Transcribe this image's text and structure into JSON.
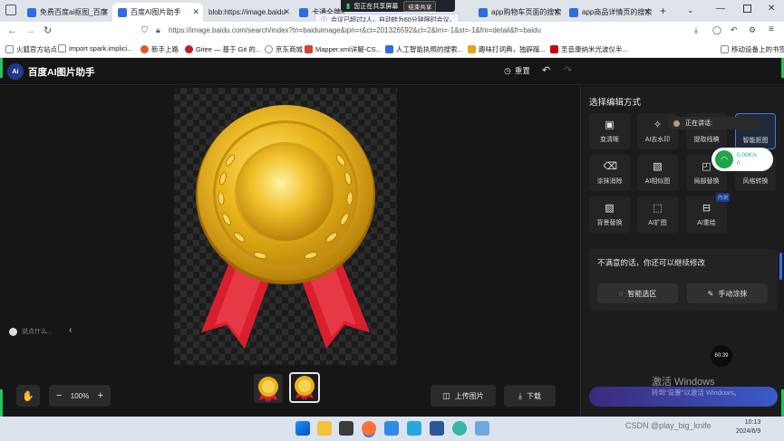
{
  "tabs": [
    {
      "label": "免费百度ai抠图_百度"
    },
    {
      "label": "百度AI图片助手"
    },
    {
      "label": "blob:https://image.baidu"
    },
    {
      "label": "卡通全牌的"
    },
    {
      "label": "app购物车页面的搜索"
    },
    {
      "label": "app商品详情页的搜索"
    }
  ],
  "share": {
    "text": "您正在共享屏幕",
    "end_label": "结束共享"
  },
  "notice": {
    "text": "会议已超过2人，自动转为60分钟限时会议。"
  },
  "address": {
    "url": "https://image.baidu.com/search/index?tn=baiduimage&ipn=r&ct=201326592&cl=2&lm=-1&st=-1&fm=detail&fr=baidu"
  },
  "bookmarks": [
    {
      "label": "火狐官方站点"
    },
    {
      "label": "import spark.implici..."
    },
    {
      "label": "新手上路"
    },
    {
      "label": "Gitee — 基于 Git 的..."
    },
    {
      "label": "京东商城"
    },
    {
      "label": "Mapper.xml详解-CS..."
    },
    {
      "label": "人工智能执照的搜索..."
    },
    {
      "label": "趣味打词典，独辟蹊..."
    },
    {
      "label": "圣音康纳米光波仪半..."
    },
    {
      "label": "移动设备上的书签"
    }
  ],
  "app": {
    "logo": "Ai",
    "title": "百度AI图片助手",
    "reset_label": "重置"
  },
  "canvas": {
    "input_placeholder": "说点什么...",
    "zoom": "100%",
    "upload_label": "上传图片",
    "download_label": "下载"
  },
  "panel": {
    "heading": "选择编辑方式",
    "tools": [
      {
        "label": "变清晰",
        "icon": "hd-icon"
      },
      {
        "label": "AI去水印",
        "icon": "magic-wand-icon"
      },
      {
        "label": "提取线稿",
        "icon": "line-art-icon"
      },
      {
        "label": "智能抠图",
        "icon": "cutout-icon"
      },
      {
        "label": "涂抹消除",
        "icon": "eraser-icon"
      },
      {
        "label": "AI相似图",
        "icon": "similar-image-icon"
      },
      {
        "label": "局部替换",
        "icon": "partial-replace-icon"
      },
      {
        "label": "风格转换",
        "icon": "style-transfer-icon"
      },
      {
        "label": "背景替换",
        "icon": "background-replace-icon"
      },
      {
        "label": "AI扩图",
        "icon": "expand-icon"
      },
      {
        "label": "AI重绘",
        "icon": "redraw-icon",
        "badge": "内测"
      }
    ],
    "retry_text": "不满意的话，你还可以继续修改",
    "smart_select_label": "智能选区",
    "manual_label": "手动涂抹",
    "speaking": "正在讲话:"
  },
  "network": {
    "down": "0.00K/s",
    "up": "0"
  },
  "timer": "60:39",
  "watermark": {
    "line1": "激活 Windows",
    "line2": "转到\"设置\"以激活 Windows。"
  },
  "taskbar": {
    "time": "10:13",
    "date": "2024/6/9",
    "csdn": "CSDN @play_big_knife"
  },
  "colors": {
    "accent": "#4a78d8",
    "medal_gold": "#e7b418",
    "ribbon_red": "#d91f2e"
  }
}
